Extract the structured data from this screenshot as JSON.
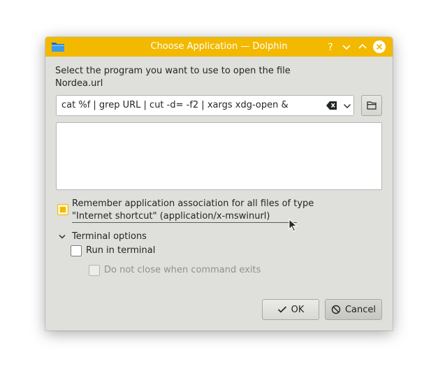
{
  "window": {
    "title": "Choose Application — Dolphin",
    "accent_color": "#f2b900",
    "icons": {
      "app": "dolphin-folder-icon",
      "help": "help-icon",
      "minimize": "minimize-icon",
      "maximize": "maximize-icon",
      "close": "close-icon"
    }
  },
  "prompt": {
    "line1": "Select the program you want to use to open the file",
    "line2": "Nordea.url"
  },
  "command": {
    "value": "cat %f | grep URL | cut -d= -f2 | xargs xdg-open &",
    "clear_icon": "clear-text-icon",
    "dropdown_icon": "chevron-down-icon",
    "browse_icon": "open-folder-icon"
  },
  "remember": {
    "checked": "partial",
    "line1": "Remember application association for all files of type",
    "line2": "\"Internet shortcut\" (application/x-mswinurl)"
  },
  "terminal": {
    "section_label": "Terminal options",
    "expanded": true,
    "run_in_terminal": {
      "label": "Run in terminal",
      "checked": false
    },
    "keep_open": {
      "label": "Do not close when command exits",
      "checked": false,
      "enabled": false
    }
  },
  "buttons": {
    "ok": "OK",
    "cancel": "Cancel"
  }
}
